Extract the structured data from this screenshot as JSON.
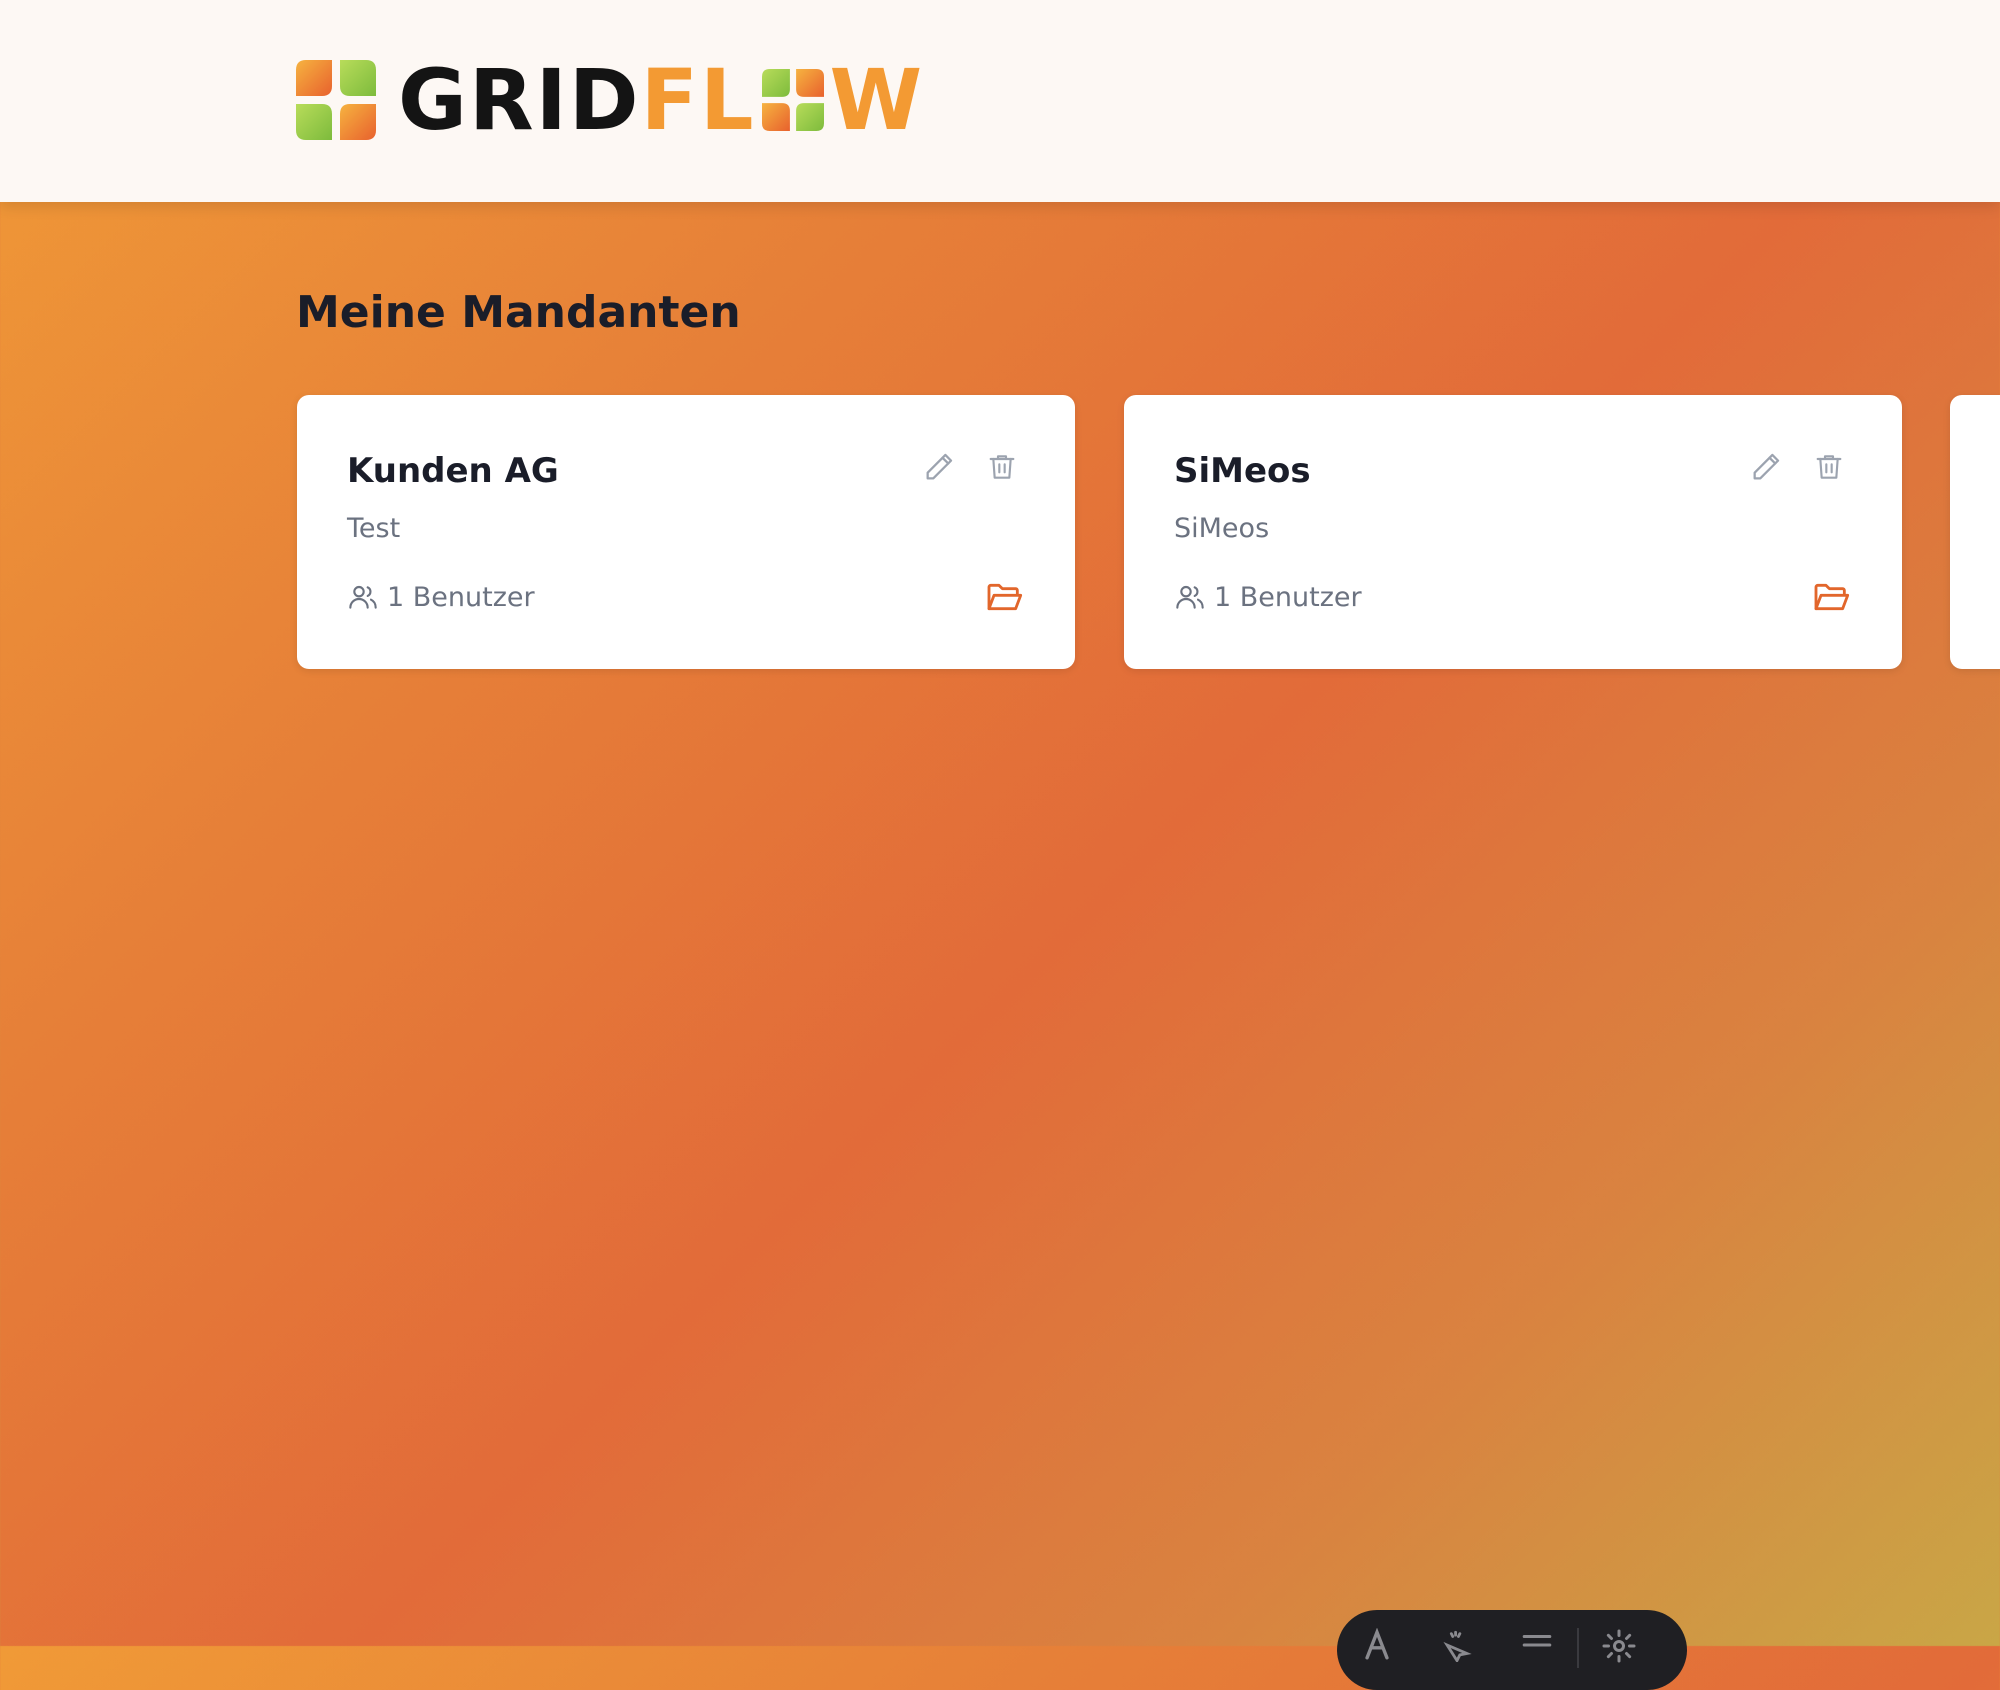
{
  "logo": {
    "grid": "GRID",
    "fl": "FL",
    "w": "W"
  },
  "page": {
    "title": "Meine Mandanten"
  },
  "colors": {
    "accent": "#e2662b",
    "icon_gray": "#9ca3af",
    "logo_orange": "#f39a33",
    "logo_green": "#8cc540"
  },
  "tenants": [
    {
      "name": "Kunden AG",
      "description": "Test",
      "users": "1 Benutzer"
    },
    {
      "name": "SiMeos",
      "description": "SiMeos",
      "users": "1 Benutzer"
    }
  ],
  "card_icons": {
    "edit": "pencil-icon",
    "delete": "trash-icon",
    "open": "folder-open-icon",
    "users": "users-icon"
  },
  "toolbar_icons": [
    "text-icon",
    "pointer-icon",
    "menu-icon",
    "settings-icon"
  ]
}
